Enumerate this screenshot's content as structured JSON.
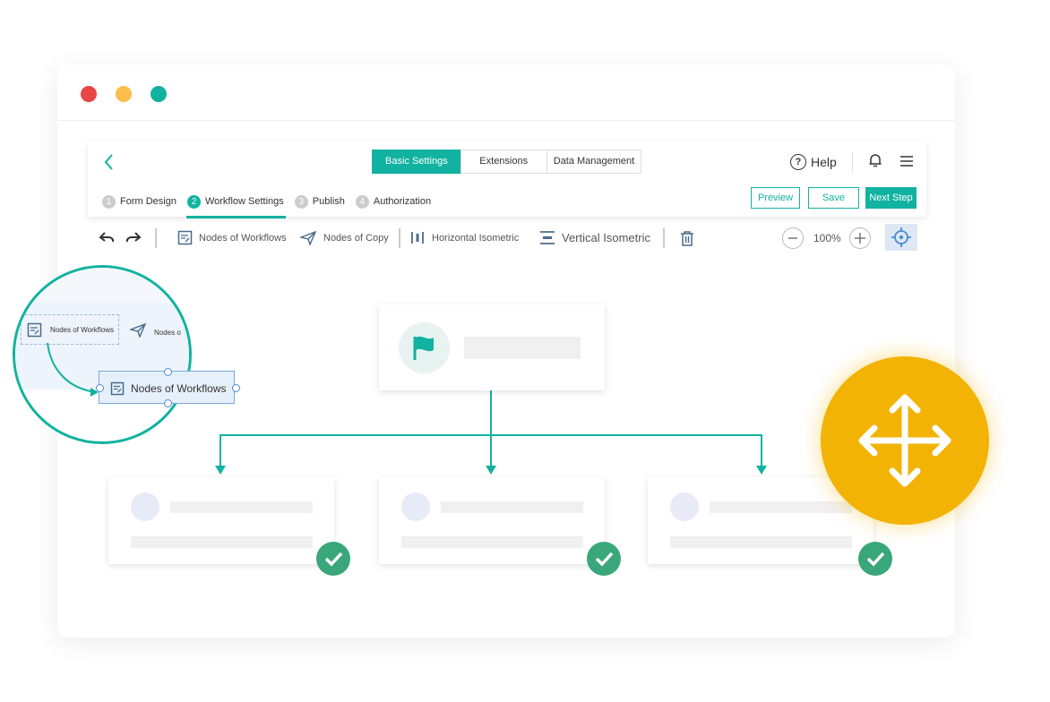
{
  "window": {
    "controls": [
      "close",
      "minimize",
      "maximize"
    ]
  },
  "header": {
    "back_icon": "chevron-left-icon",
    "tabs": [
      {
        "label": "Basic Settings",
        "active": true
      },
      {
        "label": "Extensions",
        "active": false
      },
      {
        "label": "Data Management",
        "active": false
      }
    ],
    "help_label": "Help",
    "help_glyph": "?",
    "bell_icon": "bell-icon",
    "menu_icon": "hamburger-icon"
  },
  "steps": [
    {
      "num": "1",
      "label": "Form Design",
      "active": false
    },
    {
      "num": "2",
      "label": "Workflow Settings",
      "active": true
    },
    {
      "num": "3",
      "label": "Publish",
      "active": false
    },
    {
      "num": "4",
      "label": "Authorization",
      "active": false
    }
  ],
  "actions": {
    "preview": "Preview",
    "save": "Save",
    "next": "Next Step"
  },
  "toolbar": {
    "nodes_workflows": "Nodes of Workflows",
    "nodes_copy": "Nodes of Copy",
    "horizontal": "Horizontal Isometric",
    "vertical": "Vertical Isometric",
    "zoom": "100%"
  },
  "magnifier": {
    "source_label": "Nodes of Workflows",
    "truncated_label": "Nodes o",
    "dragged_label": "Nodes of Workflows"
  },
  "colors": {
    "accent": "#11b2a0",
    "move": "#f2b304",
    "check": "#3aa77a"
  }
}
